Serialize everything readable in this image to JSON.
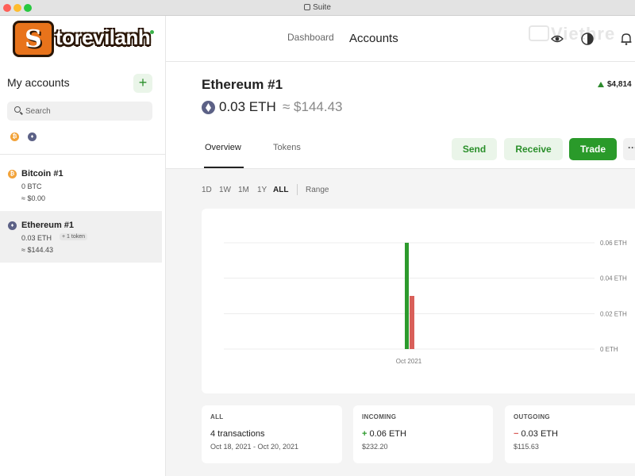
{
  "window": {
    "title": "Suite"
  },
  "logo": {
    "text": "torevilanh",
    "letter": "S"
  },
  "watermark": "Viethre",
  "nav": {
    "dashboard": "Dashboard",
    "accounts": "Accounts"
  },
  "sidebar": {
    "title": "My accounts",
    "add": "+",
    "search_placeholder": "Search",
    "accounts": [
      {
        "name": "Bitcoin #1",
        "balance": "0 BTC",
        "fiat": "≈ $0.00",
        "coin": "btc"
      },
      {
        "name": "Ethereum #1",
        "balance": "0.03 ETH",
        "fiat": "≈ $144.43",
        "coin": "eth",
        "badge": "+ 1 token"
      }
    ]
  },
  "account": {
    "title": "Ethereum #1",
    "balance": "0.03 ETH",
    "fiat": "≈ $144.43",
    "total": "$4,814"
  },
  "tabs": [
    "Overview",
    "Tokens"
  ],
  "actions": {
    "send": "Send",
    "receive": "Receive",
    "trade": "Trade",
    "more": "···"
  },
  "ranges": [
    "1D",
    "1W",
    "1M",
    "1Y",
    "ALL",
    "Range"
  ],
  "active_range": "ALL",
  "colors": {
    "incoming": "#2d9a2d",
    "outgoing": "#d9605a",
    "accent": "#2a9a2a"
  },
  "chart_data": {
    "type": "bar",
    "categories": [
      "Oct 2021"
    ],
    "series": [
      {
        "values": [
          0.06
        ]
      },
      {
        "values": [
          0.03
        ]
      }
    ],
    "y_ticks": [
      "0.06 ETH",
      "0.04 ETH",
      "0.02 ETH",
      "0 ETH"
    ],
    "ylim": [
      0,
      0.06
    ],
    "grid": true
  },
  "stats": {
    "all": {
      "label": "ALL",
      "main": "4 transactions",
      "sub": "Oct 18, 2021 - Oct 20, 2021"
    },
    "incoming": {
      "label": "INCOMING",
      "sign": "+",
      "main": "0.06 ETH",
      "sub": "$232.20"
    },
    "outgoing": {
      "label": "OUTGOING",
      "sign": "−",
      "main": "0.03 ETH",
      "sub": "$115.63"
    }
  }
}
